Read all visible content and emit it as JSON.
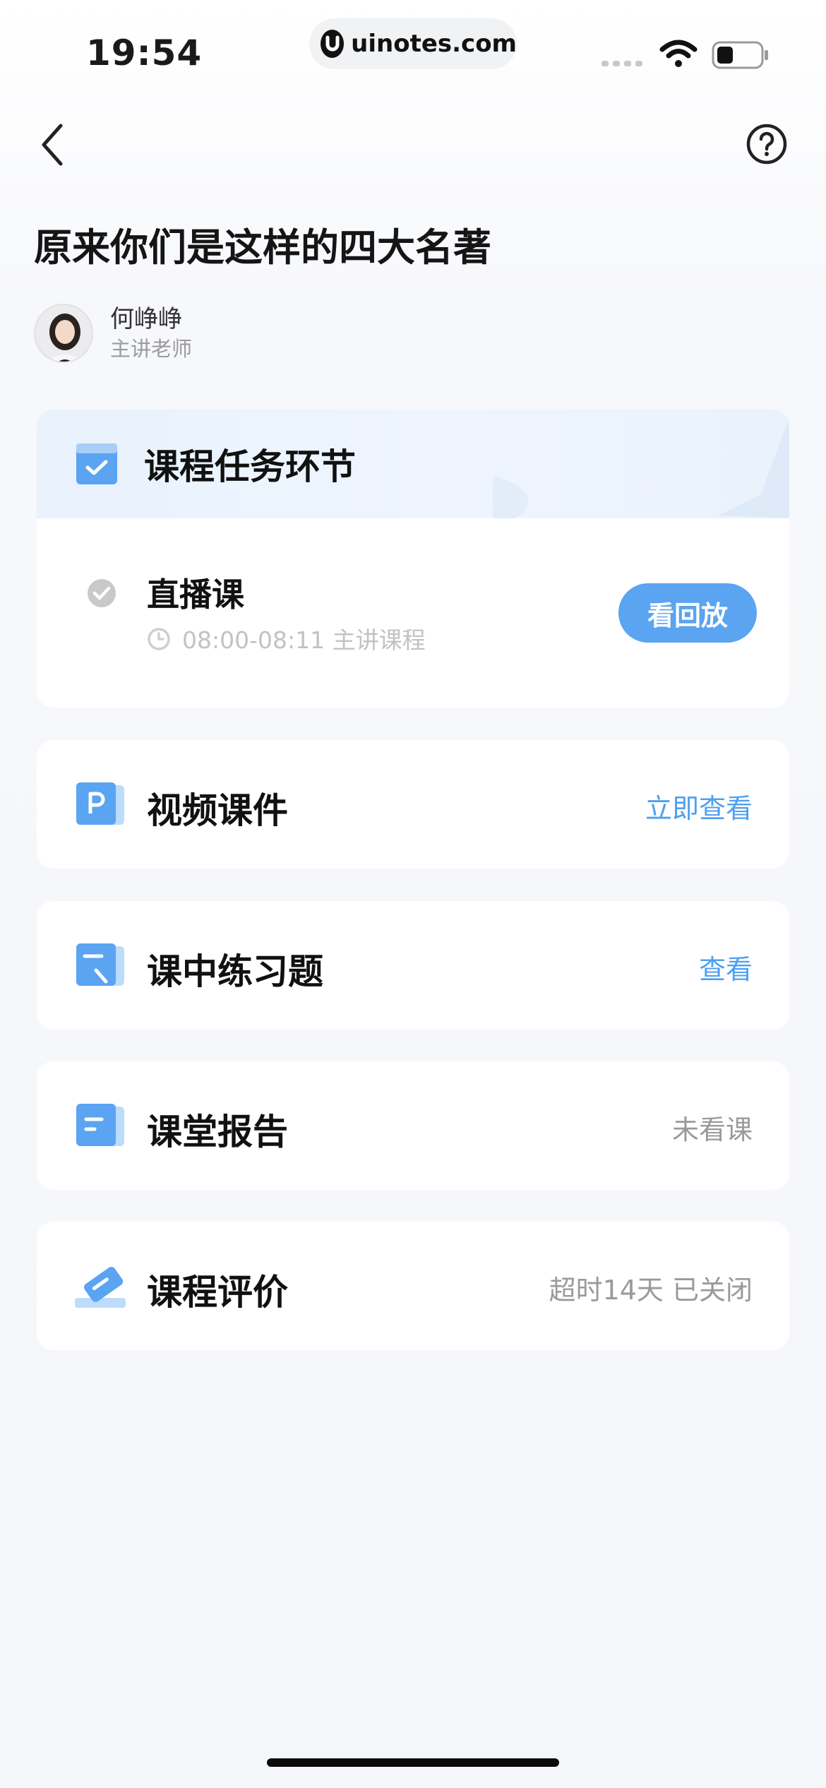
{
  "status_bar": {
    "time": "19:54",
    "url": "uinotes.com"
  },
  "nav": {
    "back_icon": "chevron-left-icon",
    "help_icon": "question-circle-icon"
  },
  "page": {
    "title": "原来你们是这样的四大名著"
  },
  "teacher": {
    "name": "何峥峥",
    "role": "主讲老师"
  },
  "task_section": {
    "header": "课程任务环节",
    "live": {
      "title": "直播课",
      "time": "08:00-08:11 主讲课程",
      "button": "看回放"
    }
  },
  "items": [
    {
      "title": "视频课件",
      "action": "立即查看",
      "icon": "ppt-icon",
      "action_color": "#4e9ff0"
    },
    {
      "title": "课中练习题",
      "action": "查看",
      "icon": "exercise-icon",
      "action_color": "#4e9ff0"
    },
    {
      "title": "课堂报告",
      "action": "未看课",
      "icon": "report-icon",
      "action_color": "#9a9a9a"
    },
    {
      "title": "课程评价",
      "action": "超时14天 已关闭",
      "icon": "eraser-icon",
      "action_color": "#9a9a9a"
    }
  ],
  "colors": {
    "accent": "#5aa4f1",
    "link": "#4e9ff0",
    "muted": "#9a9a9a"
  }
}
